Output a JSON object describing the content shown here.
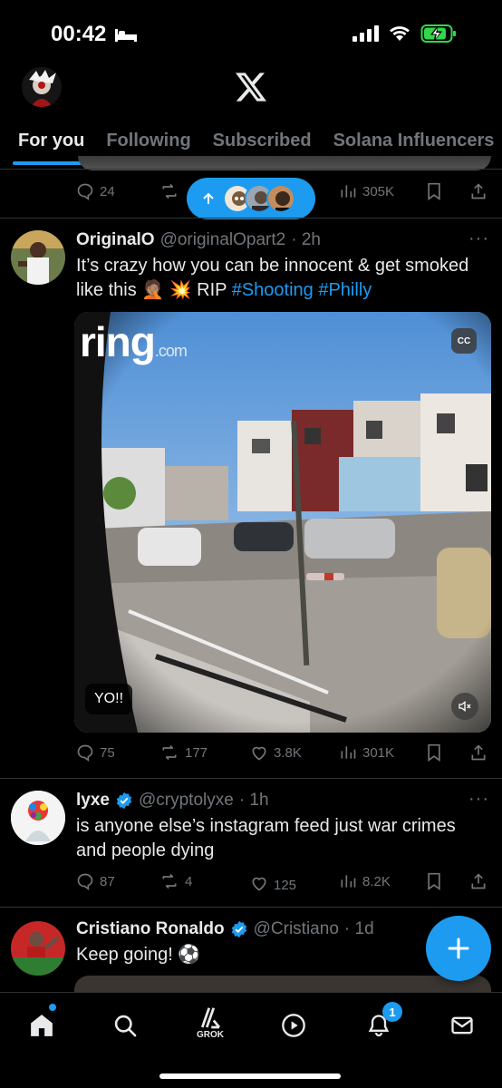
{
  "status_bar": {
    "time": "00:42",
    "battery_color": "#32d74b"
  },
  "header": {
    "logo": "x-logo-icon"
  },
  "tabs": [
    {
      "label": "For you",
      "active": true
    },
    {
      "label": "Following"
    },
    {
      "label": "Subscribed"
    },
    {
      "label": "Solana Influencers"
    }
  ],
  "prev_tweet": {
    "replies": "24",
    "views": "305K"
  },
  "new_posts_pill": {
    "icon": "arrow-up-icon",
    "avatars": 3
  },
  "tweets": [
    {
      "name": "OriginalO",
      "handle": "@originalOpart2",
      "time": "· 2h",
      "text_main": "It’s crazy how you can be innocent & get smoked like this 🤦🏽 💥 RIP ",
      "tag1": "#Shooting",
      "tag2": "#Philly",
      "media": {
        "brand": "ring",
        "brand_suffix": ".com",
        "cc": "CC",
        "caption_button": "YO!!"
      },
      "replies": "75",
      "reposts": "177",
      "likes": "3.8K",
      "views": "301K"
    },
    {
      "name": "lyxe",
      "handle": "@cryptolyxe",
      "time": "· 1h",
      "verified": true,
      "text": "is anyone else’s instagram feed just war crimes and people dying",
      "replies": "87",
      "reposts": "4",
      "likes": "125",
      "views": "8.2K"
    },
    {
      "name": "Cristiano Ronaldo",
      "handle": "@Cristiano",
      "time": "· 1d",
      "verified": true,
      "text": "Keep going! ⚽"
    }
  ],
  "bottom_nav": {
    "grok_label": "GROK",
    "notifications_badge": "1"
  },
  "accent_color": "#1d9bf0"
}
